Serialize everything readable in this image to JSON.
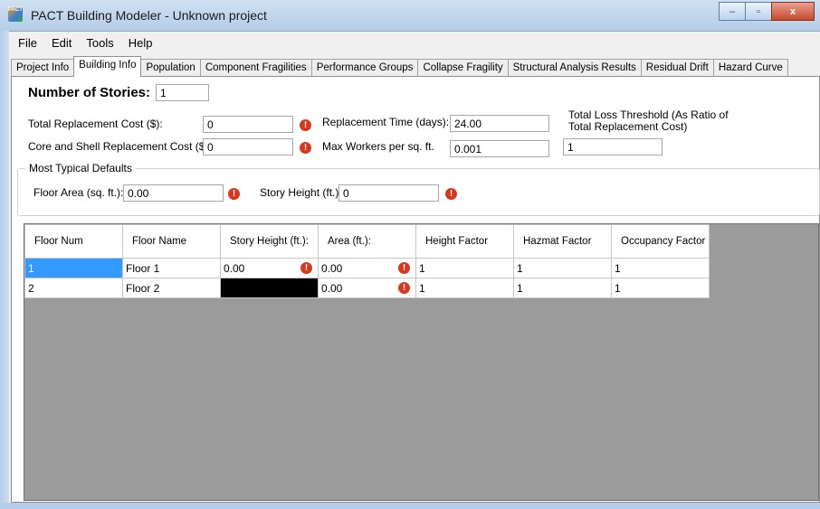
{
  "window": {
    "title": "PACT Building Modeler - Unknown project",
    "icon_text": "PACT",
    "controls": {
      "minimize": "–",
      "maximize": "▫",
      "close": "x"
    }
  },
  "menu": [
    "File",
    "Edit",
    "Tools",
    "Help"
  ],
  "tabs": [
    {
      "label": "Project Info"
    },
    {
      "label": "Building Info",
      "active": true
    },
    {
      "label": "Population"
    },
    {
      "label": "Component Fragilities"
    },
    {
      "label": "Performance Groups"
    },
    {
      "label": "Collapse Fragility"
    },
    {
      "label": "Structural Analysis Results"
    },
    {
      "label": "Residual Drift"
    },
    {
      "label": "Hazard Curve"
    }
  ],
  "building": {
    "num_stories_label": "Number of Stories:",
    "num_stories": "1",
    "total_replacement_label": "Total Replacement Cost ($):",
    "total_replacement": "0",
    "core_shell_label": "Core and Shell Replacement Cost ($):",
    "core_shell": "0",
    "replacement_time_label": "Replacement Time (days):",
    "replacement_time": "24.00",
    "max_workers_label": "Max Workers per sq. ft.",
    "max_workers": "0.001",
    "loss_threshold_label_1": "Total Loss Threshold (As Ratio of",
    "loss_threshold_label_2": "Total Replacement Cost)",
    "loss_threshold": "1"
  },
  "defaults": {
    "group_title": "Most Typical Defaults",
    "floor_area_label": "Floor Area (sq. ft.):",
    "floor_area": "0.00",
    "story_height_label": "Story Height (ft.):",
    "story_height": "0"
  },
  "error_icon": "!",
  "grid": {
    "headers": [
      "Floor Num",
      "Floor Name",
      "Story Height (ft.):",
      "Area (ft.):",
      "Height Factor",
      "Hazmat Factor",
      "Occupancy Factor"
    ],
    "rows": [
      {
        "floor_num": "1",
        "floor_name": "Floor 1",
        "story_height": "0.00",
        "area": "0.00",
        "height_factor": "1",
        "hazmat_factor": "1",
        "occupancy_factor": "1"
      },
      {
        "floor_num": "2",
        "floor_name": "Floor 2",
        "story_height": "",
        "area": "0.00",
        "height_factor": "1",
        "hazmat_factor": "1",
        "occupancy_factor": "1"
      }
    ]
  }
}
